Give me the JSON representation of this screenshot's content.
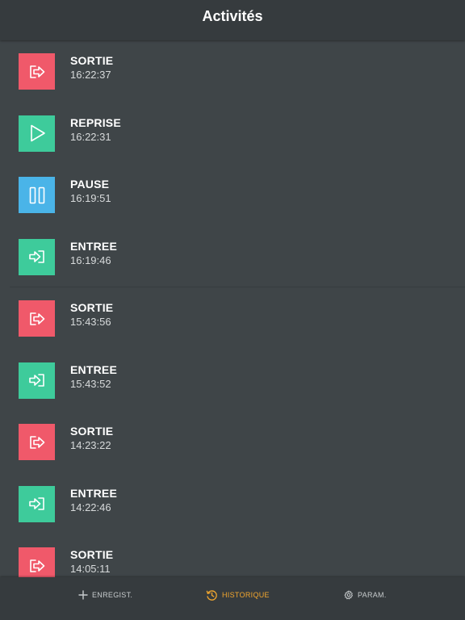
{
  "header": {
    "title": "Activités"
  },
  "colors": {
    "sortie": "#f0596a",
    "entree": "#3ecb9b",
    "reprise": "#3ecb9b",
    "pause": "#4ab4e8",
    "active_tab": "#f3a72e"
  },
  "activities": [
    {
      "type": "sortie",
      "icon": "exit-arrow-icon",
      "label": "SORTIE",
      "time": "16:22:37"
    },
    {
      "type": "reprise",
      "icon": "play-icon",
      "label": "REPRISE",
      "time": "16:22:31"
    },
    {
      "type": "pause",
      "icon": "pause-icon",
      "label": "PAUSE",
      "time": "16:19:51"
    },
    {
      "type": "entree",
      "icon": "enter-arrow-icon",
      "label": "ENTREE",
      "time": "16:19:46"
    },
    {
      "type": "sortie",
      "icon": "exit-arrow-icon",
      "label": "SORTIE",
      "time": "15:43:56"
    },
    {
      "type": "entree",
      "icon": "enter-arrow-icon",
      "label": "ENTREE",
      "time": "15:43:52"
    },
    {
      "type": "sortie",
      "icon": "exit-arrow-icon",
      "label": "SORTIE",
      "time": "14:23:22"
    },
    {
      "type": "entree",
      "icon": "enter-arrow-icon",
      "label": "ENTREE",
      "time": "14:22:46"
    },
    {
      "type": "sortie",
      "icon": "exit-arrow-icon",
      "label": "SORTIE",
      "time": "14:05:11"
    }
  ],
  "tabs": [
    {
      "label": "ENREGIST.",
      "icon": "plus-icon",
      "active": false
    },
    {
      "label": "HISTORIQUE",
      "icon": "history-icon",
      "active": true
    },
    {
      "label": "PARAM.",
      "icon": "gear-icon",
      "active": false
    }
  ]
}
